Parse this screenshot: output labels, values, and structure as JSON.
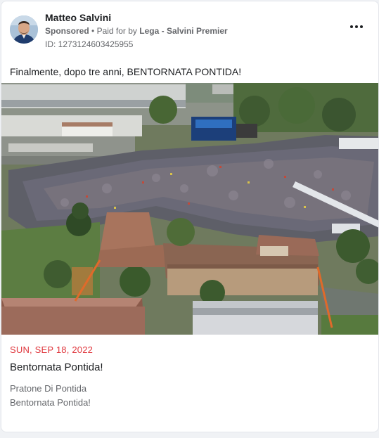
{
  "advertiser": {
    "name": "Matteo Salvini",
    "sponsored_label": "Sponsored",
    "paid_for_prefix": "Paid for by",
    "payer": "Lega - Salvini Premier",
    "library_id": "ID: 1273124603425955"
  },
  "more_icon": "ellipsis-horizontal-icon",
  "ad_text": "Finalmente, dopo tre anni, BENTORNATA PONTIDA!",
  "link_preview": {
    "date": "SUN, SEP 18, 2022",
    "headline": "Bentornata Pontida!",
    "description_line1": "Pratone Di Pontida",
    "description_line2": "Bentornata Pontida!"
  },
  "colors": {
    "date_red": "#e0383e",
    "secondary_text": "#65676b",
    "primary_text": "#1c1e21"
  }
}
